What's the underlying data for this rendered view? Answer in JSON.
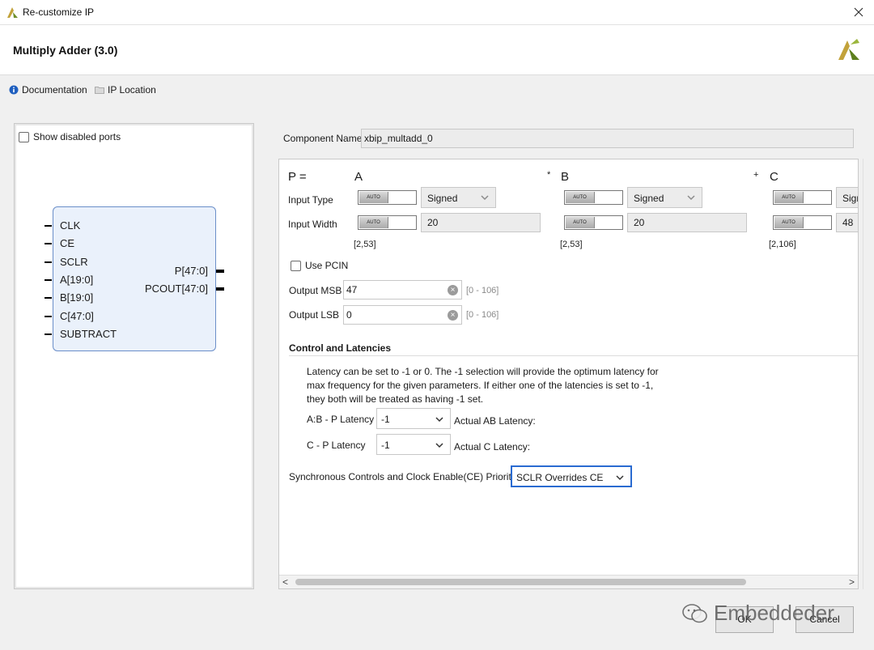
{
  "window": {
    "title": "Re-customize IP",
    "ip_title": "Multiply Adder (3.0)"
  },
  "links": {
    "documentation": "Documentation",
    "ip_location": "IP Location"
  },
  "left_panel": {
    "show_disabled_ports": "Show disabled ports",
    "inputs": [
      "CLK",
      "CE",
      "SCLR",
      "A[19:0]",
      "B[19:0]",
      "C[47:0]",
      "SUBTRACT"
    ],
    "outputs": [
      "P[47:0]",
      "PCOUT[47:0]"
    ]
  },
  "component": {
    "label": "Component Name",
    "value": "xbip_multadd_0"
  },
  "equation": {
    "p_label": "P =",
    "a_label": "A",
    "mul_op": "*",
    "b_label": "B",
    "add_op": "+",
    "c_label": "C"
  },
  "rows": {
    "input_type_label": "Input Type",
    "input_width_label": "Input Width",
    "auto_text": "AUTO"
  },
  "port_a": {
    "type": "Signed",
    "width": "20",
    "range": "[2,53]"
  },
  "port_b": {
    "type": "Signed",
    "width": "20",
    "range": "[2,53]"
  },
  "port_c": {
    "type": "Sign",
    "width": "48",
    "range": "[2,106]"
  },
  "pcin": {
    "label": "Use PCIN"
  },
  "output_msb": {
    "label": "Output MSB",
    "value": "47",
    "hint": "[0 - 106]"
  },
  "output_lsb": {
    "label": "Output LSB",
    "value": "0",
    "hint": "[0 - 106]"
  },
  "control": {
    "heading": "Control and Latencies",
    "desc_line1": "Latency can be set to -1 or 0. The -1 selection will provide the optimum latency for",
    "desc_line2": "max frequency for the given parameters. If either one of the latencies is set to -1,",
    "desc_line3": "they both will be treated as having -1 set.",
    "ab_p_label": "A:B - P Latency",
    "ab_p_value": "-1",
    "actual_ab": "Actual AB Latency:",
    "c_p_label": "C - P Latency",
    "c_p_value": "-1",
    "actual_c": "Actual C Latency:",
    "sync_label": "Synchronous Controls and Clock Enable(CE) Priority",
    "sync_value": "SCLR Overrides CE"
  },
  "buttons": {
    "ok": "OK",
    "cancel": "Cancel"
  },
  "watermark": "Embeddeder",
  "colors": {
    "accent": "#2a6bd1",
    "symbol_fill": "#eaf1fb",
    "symbol_border": "#6b8fc9"
  }
}
